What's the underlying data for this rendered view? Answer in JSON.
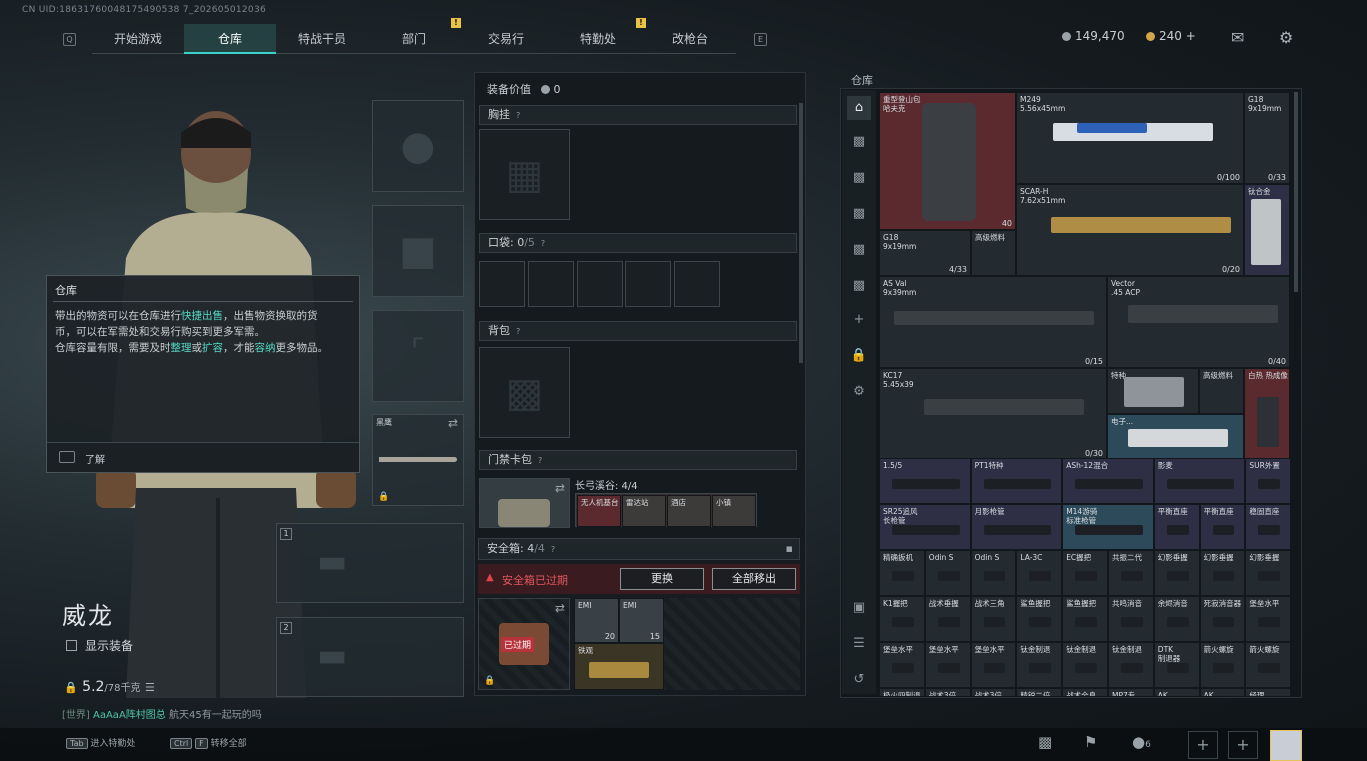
{
  "uid": "CN UID:18631760048175490538 7_202605012036",
  "nav": {
    "left_key": "Q",
    "right_key": "E",
    "tabs": [
      {
        "label": "开始游戏"
      },
      {
        "label": "仓库",
        "active": true
      },
      {
        "label": "特战干员"
      },
      {
        "label": "部门",
        "marker": "!"
      },
      {
        "label": "交易行"
      },
      {
        "label": "特勤处",
        "marker": "!"
      },
      {
        "label": "改枪台"
      }
    ]
  },
  "currency": {
    "silver": "149,470",
    "gold": "240",
    "add": "+",
    "silver_color": "#9aa3a8",
    "gold_color": "#d3a548"
  },
  "tooltip": {
    "title": "仓库",
    "line1a": "带出的物资可以在仓库进行",
    "line1b": "快捷出售",
    "line1c": "，出售物资换取的货",
    "line2": "币，可以在军需处和交易行购买到更多军需。",
    "line3a": "仓库容量有限，需要及时",
    "line3b": "整理",
    "line3c": "或",
    "line3d": "扩容",
    "line3e": "，才能",
    "line3f": "容纳",
    "line3g": "更多物品。",
    "footer": "了解"
  },
  "character": {
    "name": "威龙",
    "show_equipment": "显示装备",
    "weight": "5.2",
    "weight_max": "/78千克",
    "chat_channel": "[世界]",
    "chat_user": "AaAaA阵村图总",
    "chat_text": "航天45有一起玩的吗"
  },
  "slots": {
    "melee_name": "黑鹰",
    "slot1": "1",
    "slot2": "2"
  },
  "loadout": {
    "value_label": "装备价值",
    "value": "0",
    "chest": "胸挂",
    "pocket": "口袋: ",
    "pocket_count": "0",
    "pocket_max": "/5",
    "backpack": "背包",
    "keycard": "门禁卡包",
    "keycard_name": "长弓溪谷: 4/4",
    "keycard_labels": [
      "无人机基台",
      "雷达站",
      "酒店",
      "小镇"
    ],
    "safe_label": "安全箱: ",
    "safe_count": "4",
    "safe_max": "/4",
    "safe_expired": "安全箱已过期",
    "replace": "更换",
    "move_all": "全部移出",
    "expired_badge": "已过期",
    "safe_items": [
      "EMI",
      "EMI"
    ],
    "safe_counts": [
      "20",
      "15"
    ],
    "safe_item3": "铁观"
  },
  "warehouse": {
    "label": "仓库",
    "items": [
      {
        "name": "重型登山包\n哈夫克",
        "count": "40"
      },
      {
        "name": "M249\n5.56x45mm",
        "count": "0/100"
      },
      {
        "name": "G18\n9x19mm",
        "count": "0/33"
      },
      {
        "name": "SCAR-H\n7.62x51mm",
        "count": "0/20"
      },
      {
        "name": "钛合金",
        "count": ""
      },
      {
        "name": "G18\n9x19mm",
        "count": "4/33"
      },
      {
        "name": "高级燃料",
        "count": ""
      },
      {
        "name": "AS Val\n9x39mm",
        "count": "0/15"
      },
      {
        "name": "Vector\n.45 ACP",
        "count": "0/40"
      },
      {
        "name": "KC17\n5.45x39",
        "count": "0/30"
      },
      {
        "name": "特种...",
        "count": ""
      },
      {
        "name": "高级燃料",
        "count": ""
      },
      {
        "name": "白热 热成像",
        "count": ""
      },
      {
        "name": "电子...",
        "count": ""
      },
      {
        "name": "1.5/5",
        "count": ""
      },
      {
        "name": "PT1特种",
        "count": ""
      },
      {
        "name": "ASh-12混合",
        "count": ""
      },
      {
        "name": "影麦",
        "count": ""
      },
      {
        "name": "SUR外置",
        "count": ""
      },
      {
        "name": "SR25追风\n长枪管",
        "count": ""
      },
      {
        "name": "月影枪管",
        "count": ""
      },
      {
        "name": "M14游骑\n标准枪管",
        "count": ""
      },
      {
        "name": "平衡直座",
        "count": ""
      },
      {
        "name": "平衡直座",
        "count": ""
      },
      {
        "name": "稳固直座",
        "count": ""
      },
      {
        "name": "精确扳机",
        "count": ""
      },
      {
        "name": "Odin S",
        "count": ""
      },
      {
        "name": "Odin S",
        "count": ""
      },
      {
        "name": "LA-3C",
        "count": ""
      },
      {
        "name": "EC握把",
        "count": ""
      },
      {
        "name": "共振二代",
        "count": ""
      },
      {
        "name": "幻影垂握",
        "count": ""
      },
      {
        "name": "幻影垂握",
        "count": ""
      },
      {
        "name": "幻影垂握",
        "count": ""
      },
      {
        "name": "K1握把",
        "count": ""
      },
      {
        "name": "战术垂握",
        "count": ""
      },
      {
        "name": "战术三角",
        "count": ""
      },
      {
        "name": "鲨鱼握把",
        "count": ""
      },
      {
        "name": "鲨鱼握把",
        "count": ""
      },
      {
        "name": "共鸣消音",
        "count": ""
      },
      {
        "name": "余烬消音",
        "count": ""
      },
      {
        "name": "死寂消音器",
        "count": ""
      },
      {
        "name": "堡垒水平",
        "count": ""
      },
      {
        "name": "堡垒水平",
        "count": ""
      },
      {
        "name": "堡垒水平",
        "count": ""
      },
      {
        "name": "堡垒水平",
        "count": ""
      },
      {
        "name": "钛金制退",
        "count": ""
      },
      {
        "name": "钛金制退",
        "count": ""
      },
      {
        "name": "钛金制退",
        "count": ""
      },
      {
        "name": "DTK\n制退器",
        "count": ""
      },
      {
        "name": "箭火螺旋",
        "count": ""
      },
      {
        "name": "箭火螺旋",
        "count": ""
      },
      {
        "name": "极火四制退",
        "count": ""
      },
      {
        "name": "战术3倍",
        "count": ""
      },
      {
        "name": "战术3倍",
        "count": ""
      },
      {
        "name": "精锐二倍",
        "count": ""
      },
      {
        "name": "战术全息",
        "count": ""
      },
      {
        "name": "MP7专",
        "count": ""
      },
      {
        "name": "AK",
        "count": ""
      },
      {
        "name": "AK",
        "count": ""
      },
      {
        "name": "经理",
        "count": ""
      }
    ]
  },
  "bottom": {
    "tab_key": "Tab",
    "tab_label": "进入特勤处",
    "ctrl_key": "Ctrl",
    "f_key": "F",
    "ctrl_label": "转移全部",
    "friends": "6"
  },
  "icons": [
    "mail-icon",
    "gear-icon",
    "chart-icon",
    "flag-icon",
    "friends-icon",
    "plus-icon",
    "avatar"
  ]
}
